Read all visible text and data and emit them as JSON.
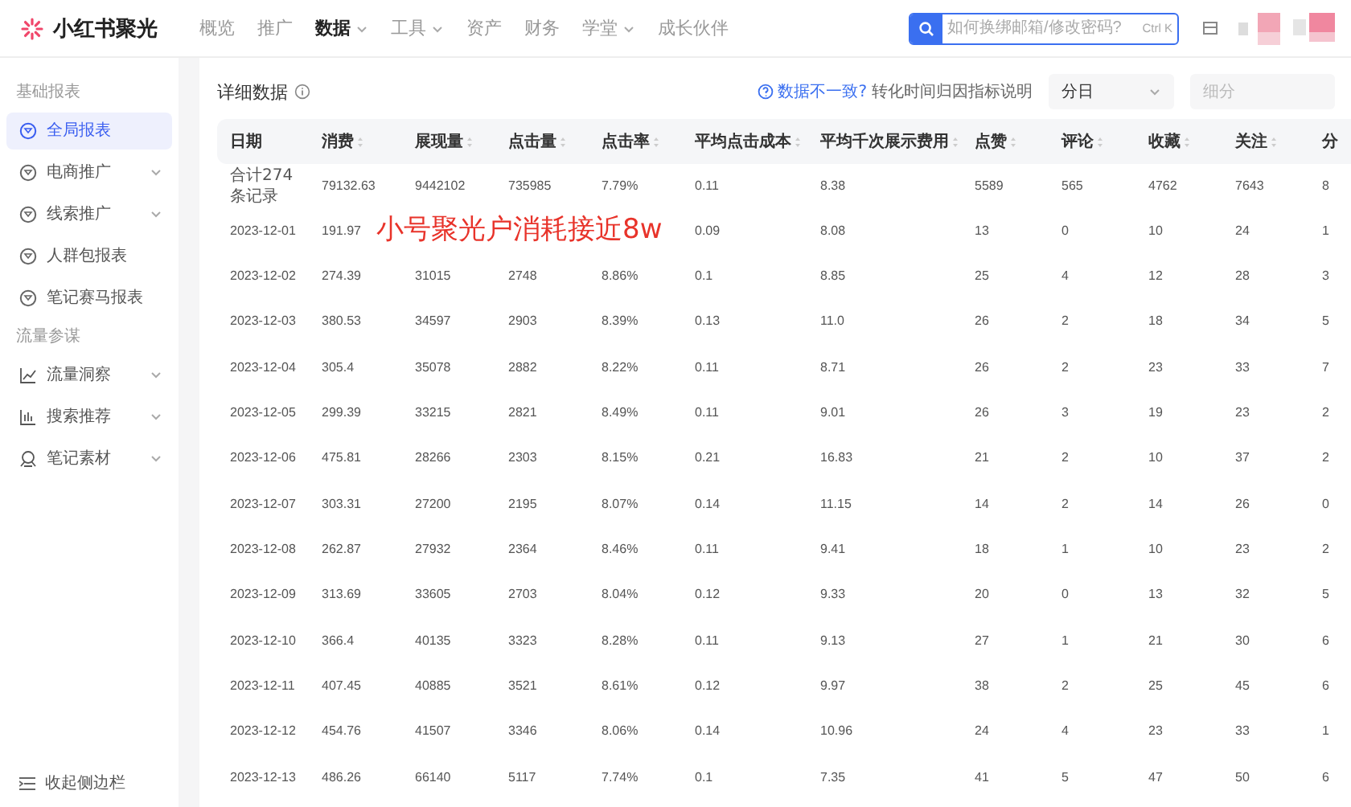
{
  "brand": {
    "name": "小红书聚光"
  },
  "nav": [
    {
      "label": "概览",
      "selected": false,
      "has_menu": false
    },
    {
      "label": "推广",
      "selected": false,
      "has_menu": false
    },
    {
      "label": "数据",
      "selected": true,
      "has_menu": true
    },
    {
      "label": "工具",
      "selected": false,
      "has_menu": true
    },
    {
      "label": "资产",
      "selected": false,
      "has_menu": false
    },
    {
      "label": "财务",
      "selected": false,
      "has_menu": false
    },
    {
      "label": "学堂",
      "selected": false,
      "has_menu": true
    },
    {
      "label": "成长伙伴",
      "selected": false,
      "has_menu": false
    }
  ],
  "search": {
    "placeholder": "如何换绑邮箱/修改密码?",
    "shortcut": "Ctrl K"
  },
  "sidebar": {
    "sections": [
      {
        "title": "基础报表",
        "items": [
          {
            "label": "全局报表",
            "selected": true,
            "expandable": false
          },
          {
            "label": "电商推广",
            "selected": false,
            "expandable": true
          },
          {
            "label": "线索推广",
            "selected": false,
            "expandable": true
          },
          {
            "label": "人群包报表",
            "selected": false,
            "expandable": false
          },
          {
            "label": "笔记赛马报表",
            "selected": false,
            "expandable": false
          }
        ]
      },
      {
        "title": "流量参谋",
        "items": [
          {
            "label": "流量洞察",
            "selected": false,
            "expandable": true
          },
          {
            "label": "搜索推荐",
            "selected": false,
            "expandable": true
          },
          {
            "label": "笔记素材",
            "selected": false,
            "expandable": true
          }
        ]
      }
    ],
    "collapse": "收起侧边栏"
  },
  "content": {
    "title": "详细数据",
    "inconsistency_link": "数据不一致?",
    "attribution_note": "转化时间归因指标说明",
    "granularity": "分日",
    "breakdown_placeholder": "细分"
  },
  "table": {
    "columns": [
      {
        "label": "日期",
        "sortable": false
      },
      {
        "label": "消费",
        "sortable": true
      },
      {
        "label": "展现量",
        "sortable": true
      },
      {
        "label": "点击量",
        "sortable": true
      },
      {
        "label": "点击率",
        "sortable": true
      },
      {
        "label": "平均点击成本",
        "sortable": true
      },
      {
        "label": "平均千次展示费用",
        "sortable": true
      },
      {
        "label": "点赞",
        "sortable": true
      },
      {
        "label": "评论",
        "sortable": true
      },
      {
        "label": "收藏",
        "sortable": true
      },
      {
        "label": "关注",
        "sortable": true
      },
      {
        "label": "分",
        "sortable": false
      }
    ],
    "rows": [
      {
        "kind": "total",
        "cells": [
          "合计274条记录",
          "79132.63",
          "9442102",
          "735985",
          "7.79%",
          "0.11",
          "8.38",
          "5589",
          "565",
          "4762",
          "7643",
          "8"
        ]
      },
      {
        "kind": "day",
        "cells": [
          "2023-12-01",
          "191.97",
          null,
          null,
          null,
          "0.09",
          "8.08",
          "13",
          "0",
          "10",
          "24",
          "1"
        ]
      },
      {
        "kind": "day",
        "cells": [
          "2023-12-02",
          "274.39",
          "31015",
          "2748",
          "8.86%",
          "0.1",
          "8.85",
          "25",
          "4",
          "12",
          "28",
          "3"
        ]
      },
      {
        "kind": "day",
        "cells": [
          "2023-12-03",
          "380.53",
          "34597",
          "2903",
          "8.39%",
          "0.13",
          "11.0",
          "26",
          "2",
          "18",
          "34",
          "5"
        ]
      },
      {
        "kind": "day",
        "cells": [
          "2023-12-04",
          "305.4",
          "35078",
          "2882",
          "8.22%",
          "0.11",
          "8.71",
          "26",
          "2",
          "23",
          "33",
          "7"
        ]
      },
      {
        "kind": "day",
        "cells": [
          "2023-12-05",
          "299.39",
          "33215",
          "2821",
          "8.49%",
          "0.11",
          "9.01",
          "26",
          "3",
          "19",
          "23",
          "2"
        ]
      },
      {
        "kind": "day",
        "cells": [
          "2023-12-06",
          "475.81",
          "28266",
          "2303",
          "8.15%",
          "0.21",
          "16.83",
          "21",
          "2",
          "10",
          "37",
          "2"
        ]
      },
      {
        "kind": "day",
        "cells": [
          "2023-12-07",
          "303.31",
          "27200",
          "2195",
          "8.07%",
          "0.14",
          "11.15",
          "14",
          "2",
          "14",
          "26",
          "0"
        ]
      },
      {
        "kind": "day",
        "cells": [
          "2023-12-08",
          "262.87",
          "27932",
          "2364",
          "8.46%",
          "0.11",
          "9.41",
          "18",
          "1",
          "10",
          "23",
          "2"
        ]
      },
      {
        "kind": "day",
        "cells": [
          "2023-12-09",
          "313.69",
          "33605",
          "2703",
          "8.04%",
          "0.12",
          "9.33",
          "20",
          "0",
          "13",
          "32",
          "5"
        ]
      },
      {
        "kind": "day",
        "cells": [
          "2023-12-10",
          "366.4",
          "40135",
          "3323",
          "8.28%",
          "0.11",
          "9.13",
          "27",
          "1",
          "21",
          "30",
          "6"
        ]
      },
      {
        "kind": "day",
        "cells": [
          "2023-12-11",
          "407.45",
          "40885",
          "3521",
          "8.61%",
          "0.12",
          "9.97",
          "38",
          "2",
          "25",
          "45",
          "6"
        ]
      },
      {
        "kind": "day",
        "cells": [
          "2023-12-12",
          "454.76",
          "41507",
          "3346",
          "8.06%",
          "0.14",
          "10.96",
          "24",
          "4",
          "23",
          "33",
          "1"
        ]
      },
      {
        "kind": "day",
        "cells": [
          "2023-12-13",
          "486.26",
          "66140",
          "5117",
          "7.74%",
          "0.1",
          "7.35",
          "41",
          "5",
          "47",
          "50",
          "6"
        ]
      }
    ]
  },
  "annotation": "小号聚光户消耗接近8w"
}
